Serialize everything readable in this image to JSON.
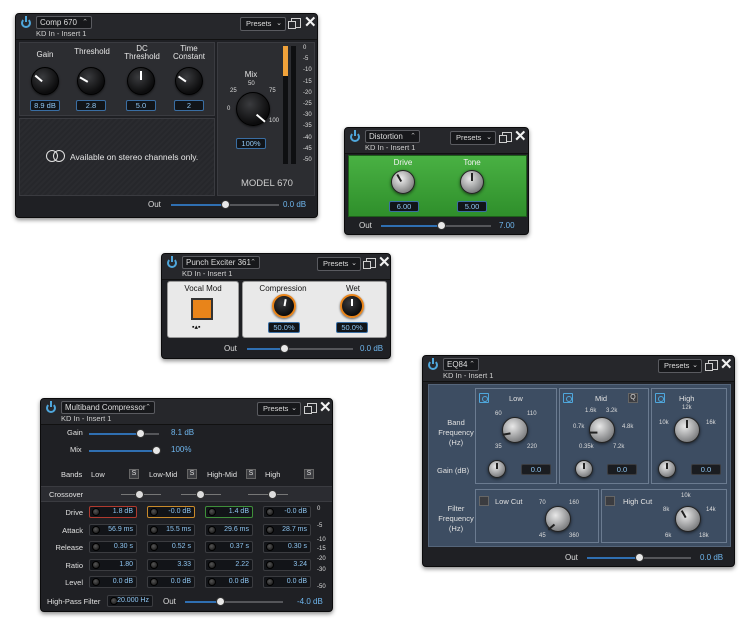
{
  "comp670": {
    "title": "Comp 670",
    "sub": "KD In - Insert 1",
    "presets": "Presets",
    "knobs": [
      {
        "label1": "",
        "label2": "Gain",
        "value": "8.9 dB"
      },
      {
        "label1": "",
        "label2": "Threshold",
        "value": "2.8"
      },
      {
        "label1": "DC",
        "label2": "Threshold",
        "value": "5.0"
      },
      {
        "label1": "Time",
        "label2": "Constant",
        "value": "2"
      }
    ],
    "mix_label": "Mix",
    "mix_value": "100%",
    "mix_ticks": [
      "0",
      "25",
      "50",
      "75",
      "100"
    ],
    "notice": "Available on stereo channels only.",
    "model": "MODEL 670",
    "meter_scale": [
      "0",
      "-5",
      "-10",
      "-15",
      "-20",
      "-25",
      "-30",
      "-35",
      "-40",
      "-45",
      "-50"
    ],
    "out_label": "Out",
    "out_value": "0.0 dB",
    "meter_level": 0.25,
    "out_level": 0.5
  },
  "distortion": {
    "title": "Distortion",
    "sub": "KD In - Insert 1",
    "presets": "Presets",
    "drive_label": "Drive",
    "drive_value": "6.00",
    "tone_label": "Tone",
    "tone_value": "5.00",
    "out_label": "Out",
    "out_value": "7.00",
    "out_level": 0.55,
    "accent": "#3ea33a"
  },
  "exciter": {
    "title": "Punch Exciter 361",
    "sub": "KD In - Insert 1",
    "presets": "Presets",
    "vocal_label": "Vocal Mod",
    "comp_label": "Compression",
    "comp_value": "50.0%",
    "wet_label": "Wet",
    "wet_value": "50.0%",
    "out_label": "Out",
    "out_value": "0.0 dB",
    "out_level": 0.35,
    "accent": "#e8841a"
  },
  "multiband": {
    "title": "Multiband Compressor",
    "sub": "KD In - Insert 1",
    "presets": "Presets",
    "gain_label": "Gain",
    "gain_value": "8.1 dB",
    "gain_level": 0.55,
    "mix_label": "Mix",
    "mix_value": "100%",
    "mix_level": 1,
    "bands_label": "Bands",
    "bands": [
      "Low",
      "Low-Mid",
      "High-Mid",
      "High"
    ],
    "solo": "S",
    "crossover_label": "Crossover",
    "rows": [
      {
        "name": "Drive",
        "values": [
          "1.8 dB",
          "-0.0 dB",
          "1.4 dB",
          "-0.0 dB"
        ]
      },
      {
        "name": "Attack",
        "values": [
          "56.9 ms",
          "15.5 ms",
          "29.6 ms",
          "28.7 ms"
        ]
      },
      {
        "name": "Release",
        "values": [
          "0.30 s",
          "0.52 s",
          "0.37 s",
          "0.30 s"
        ]
      },
      {
        "name": "Ratio",
        "values": [
          "1.80",
          "3.33",
          "2.22",
          "3.24"
        ]
      },
      {
        "name": "Level",
        "values": [
          "0.0 dB",
          "0.0 dB",
          "0.0 dB",
          "0.0 dB"
        ]
      }
    ],
    "meter_scale": [
      "0",
      "-5",
      "-10",
      "-15",
      "-20",
      "-30",
      "-50"
    ],
    "hpf_label": "High-Pass Filter",
    "hpf_value": "20.000 Hz",
    "out_label": "Out",
    "out_value": "-4.0 dB",
    "out_level": 0.25
  },
  "eq84": {
    "title": "EQ84",
    "sub": "KD In - Insert 1",
    "presets": "Presets",
    "band_freq_label": "Band Frequency (Hz)",
    "gain_label": "Gain (dB)",
    "filter_label": "Filter Frequency (Hz)",
    "low": {
      "name": "Low",
      "ticks": [
        "60",
        "110",
        "35",
        "220"
      ],
      "gain": "0.0"
    },
    "mid": {
      "name": "Mid",
      "q": "Q",
      "ticks": [
        "1.6k",
        "3.2k",
        "0.7k",
        "4.8k",
        "0.35k",
        "7.2k"
      ],
      "gain": "0.0"
    },
    "high": {
      "name": "High",
      "ticks": [
        "12k",
        "10k",
        "16k"
      ],
      "gain": "0.0"
    },
    "lowcut": {
      "name": "Low Cut",
      "ticks": [
        "70",
        "160",
        "45",
        "360"
      ]
    },
    "highcut": {
      "name": "High Cut",
      "ticks": [
        "10k",
        "8k",
        "14k",
        "6k",
        "18k"
      ]
    },
    "out_label": "Out",
    "out_value": "0.0 dB",
    "out_level": 0.5
  }
}
